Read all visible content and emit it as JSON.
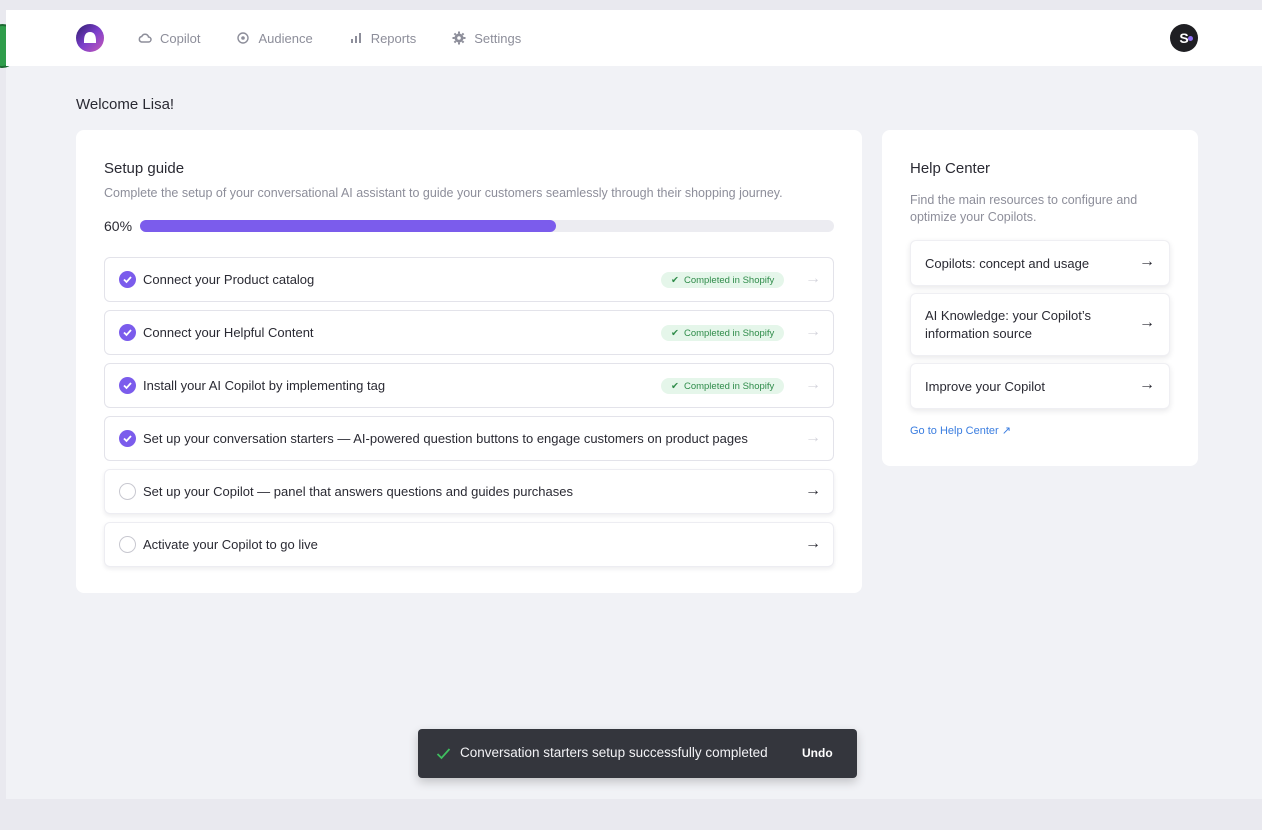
{
  "nav": {
    "items": [
      {
        "label": "Copilot",
        "icon": "cloud-icon"
      },
      {
        "label": "Audience",
        "icon": "target-icon"
      },
      {
        "label": "Reports",
        "icon": "bar-chart-icon"
      },
      {
        "label": "Settings",
        "icon": "gear-icon"
      }
    ],
    "avatar_initial": "S"
  },
  "welcome": "Welcome Lisa!",
  "setup": {
    "title": "Setup guide",
    "description": "Complete the setup of your conversational AI assistant to guide your customers seamlessly through their shopping journey.",
    "progress_label": "60%",
    "progress_value": 0.6,
    "steps": [
      {
        "label": "Connect your Product catalog",
        "done": true,
        "badge": "Completed in Shopify"
      },
      {
        "label": "Connect your Helpful Content",
        "done": true,
        "badge": "Completed in Shopify"
      },
      {
        "label": "Install your AI Copilot by implementing tag",
        "done": true,
        "badge": "Completed in Shopify"
      },
      {
        "label": "Set up your conversation starters — AI-powered question buttons to engage customers on product pages",
        "done": true,
        "badge": ""
      },
      {
        "label": "Set up your Copilot — panel that answers questions and guides purchases",
        "done": false,
        "badge": ""
      },
      {
        "label": "Activate your Copilot to go live",
        "done": false,
        "badge": ""
      }
    ],
    "arrow": "→"
  },
  "help": {
    "title": "Help Center",
    "description": "Find the main resources to configure and optimize your Copilots.",
    "links": [
      {
        "label": "Copilots: concept and usage"
      },
      {
        "label": "AI Knowledge: your Copilot’s information source"
      },
      {
        "label": "Improve your Copilot"
      }
    ],
    "goto_label": "Go to Help Center ↗"
  },
  "toast": {
    "message": "Conversation starters setup successfully completed",
    "undo_label": "Undo"
  },
  "colors": {
    "accent": "#7b5cec",
    "success_bg": "#e5f6ea",
    "success_text": "#2f8c4a",
    "link": "#3a7de0"
  }
}
